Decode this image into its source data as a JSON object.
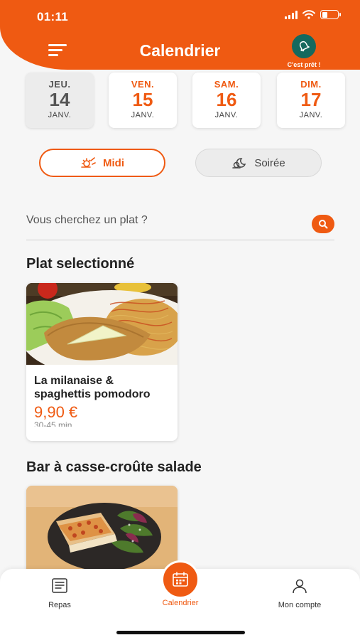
{
  "status_bar": {
    "time": "01:11"
  },
  "header": {
    "title": "Calendrier",
    "notify_label": "C'est prêt !"
  },
  "days": [
    {
      "name": "JEU.",
      "num": "14",
      "month": "JANV."
    },
    {
      "name": "VEN.",
      "num": "15",
      "month": "JANV."
    },
    {
      "name": "SAM.",
      "num": "16",
      "month": "JANV."
    },
    {
      "name": "DIM.",
      "num": "17",
      "month": "JANV."
    }
  ],
  "meal_tabs": {
    "midi": "Midi",
    "soiree": "Soirée"
  },
  "search": {
    "placeholder": "Vous cherchez un plat ?"
  },
  "sections": [
    {
      "title": "Plat selectionné",
      "dishes": [
        {
          "name": "La milanaise & spaghettis pomodoro",
          "price": "9,90 €",
          "time": "30-45 min"
        }
      ]
    },
    {
      "title": "Bar à casse-croûte salade"
    }
  ],
  "tabbar": {
    "repas": "Repas",
    "calendrier": "Calendrier",
    "compte": "Mon compte"
  },
  "colors": {
    "accent": "#ef5a12",
    "bell": "#15695e"
  }
}
